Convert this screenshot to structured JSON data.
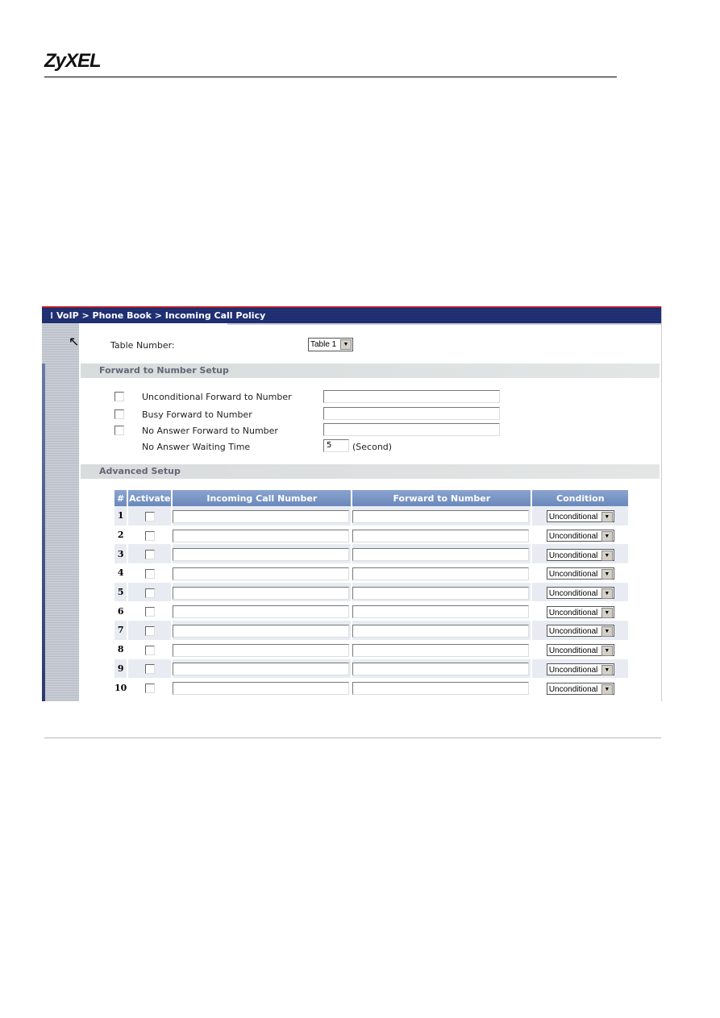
{
  "logo": "ZyXEL",
  "breadcrumb": "VoIP > Phone Book > Incoming Call Policy",
  "table_number": {
    "label": "Table Number:",
    "value": "Table 1"
  },
  "forward_setup": {
    "title": "Forward to Number Setup",
    "items": [
      {
        "label": "Unconditional Forward to Number",
        "checked": false,
        "value": ""
      },
      {
        "label": "Busy Forward to Number",
        "checked": false,
        "value": ""
      },
      {
        "label": "No Answer Forward to Number",
        "checked": false,
        "value": ""
      }
    ],
    "wait_label": "No Answer Waiting Time",
    "wait_value": "5",
    "wait_unit": "(Second)"
  },
  "advanced": {
    "title": "Advanced Setup",
    "headers": [
      "#",
      "Activate",
      "Incoming Call Number",
      "Forward to Number",
      "Condition"
    ],
    "rows": [
      {
        "n": "1",
        "condition": "Unconditional"
      },
      {
        "n": "2",
        "condition": "Unconditional"
      },
      {
        "n": "3",
        "condition": "Unconditional"
      },
      {
        "n": "4",
        "condition": "Unconditional"
      },
      {
        "n": "5",
        "condition": "Unconditional"
      },
      {
        "n": "6",
        "condition": "Unconditional"
      },
      {
        "n": "7",
        "condition": "Unconditional"
      },
      {
        "n": "8",
        "condition": "Unconditional"
      },
      {
        "n": "9",
        "condition": "Unconditional"
      },
      {
        "n": "10",
        "condition": "Unconditional"
      }
    ]
  }
}
